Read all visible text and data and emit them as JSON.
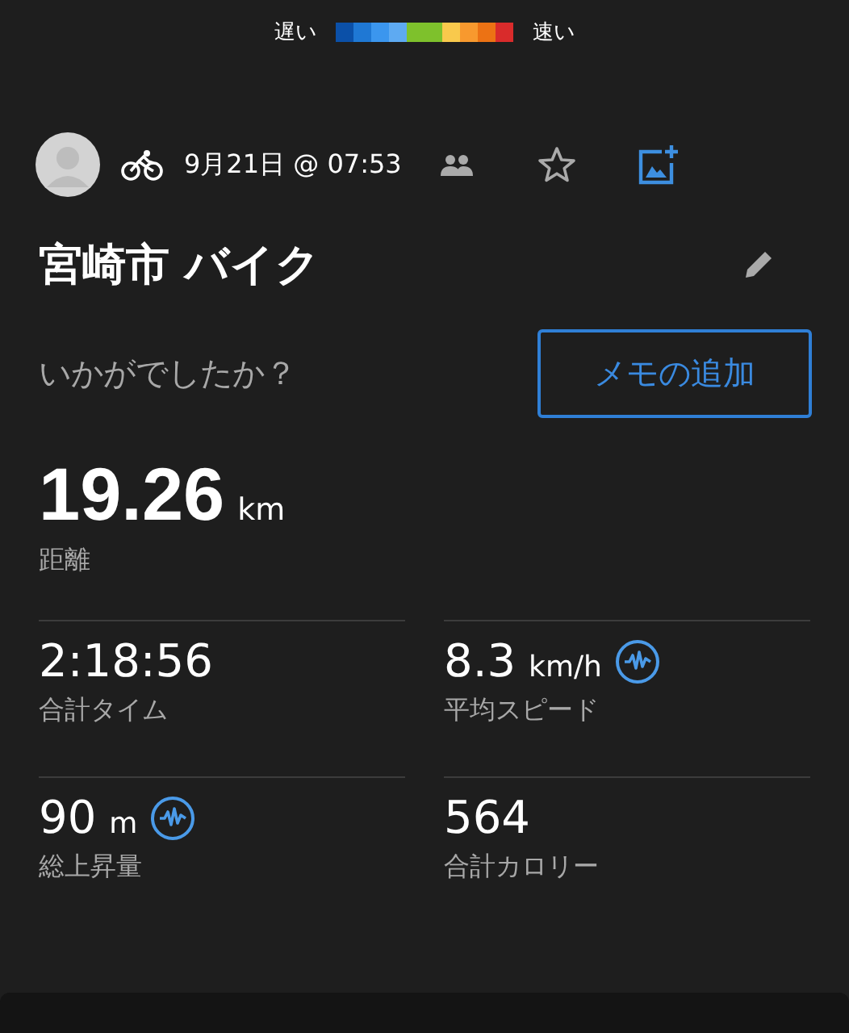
{
  "speed_legend": {
    "slow_label": "遅い",
    "fast_label": "速い",
    "segments": [
      {
        "color": "#0b50a8"
      },
      {
        "color": "#1f78d4"
      },
      {
        "color": "#3b96ee"
      },
      {
        "color": "#5eaaf2"
      },
      {
        "color": "#7ec12c"
      },
      {
        "color": "#7ec12c"
      },
      {
        "color": "#f9c94c"
      },
      {
        "color": "#f8992e"
      },
      {
        "color": "#ec7214"
      },
      {
        "color": "#d92b2b"
      }
    ]
  },
  "activity": {
    "date": "9月21日 @ 07:53",
    "title": "宮崎市 バイク",
    "prompt": "いかがでしたか？",
    "add_note_button": "メモの追加"
  },
  "distance": {
    "value": "19.26",
    "unit": "km",
    "label": "距離"
  },
  "stats": [
    {
      "value": "2:18:56",
      "label": "合計タイム",
      "graph": false
    },
    {
      "value": "8.3",
      "unit": "km/h",
      "label": "平均スピード",
      "graph": true
    },
    {
      "value": "90",
      "unit": "m",
      "label": "総上昇量",
      "graph": true
    },
    {
      "value": "564",
      "label": "合計カロリー",
      "graph": false
    }
  ]
}
